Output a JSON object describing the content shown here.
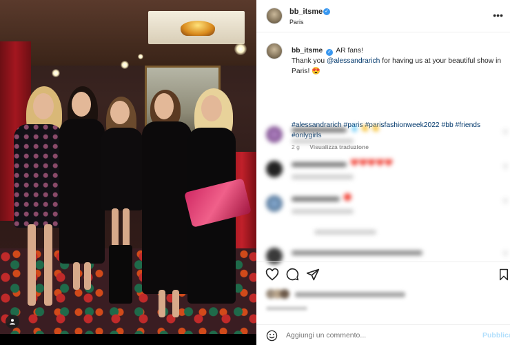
{
  "post": {
    "username": "bb_itsme",
    "location": "Paris",
    "more_icon": "ellipsis-icon",
    "verified_icon": "verified-badge-icon"
  },
  "caption": {
    "username": "bb_itsme",
    "line1": "AR fans!",
    "thank_prefix": "Thank you ",
    "mention": "@alessandrarich",
    "thank_suffix": " for having us at your beautiful show in Paris! 😍",
    "hashtags": "#alessandrarich #paris #parisfashionweek2022 #bb #friends #onlygirls",
    "age": "2 g",
    "translate": "Visualizza traduzione"
  },
  "comments": [
    {
      "emoji": "💧 👏 👏"
    },
    {
      "emoji": "❤️❤️❤️❤️❤️"
    },
    {
      "emoji": "🔴"
    }
  ],
  "actions": {
    "like_icon": "heart-icon",
    "comment_icon": "comment-icon",
    "share_icon": "send-icon",
    "save_icon": "bookmark-icon"
  },
  "add_comment": {
    "placeholder": "Aggiungi un commento...",
    "post_label": "Pubblica",
    "emoji_icon": "smiley-icon"
  },
  "colors": {
    "link": "#00376b",
    "verified": "#3897f0",
    "publish_disabled": "#b2dffc",
    "muted": "#8e8e8e"
  }
}
